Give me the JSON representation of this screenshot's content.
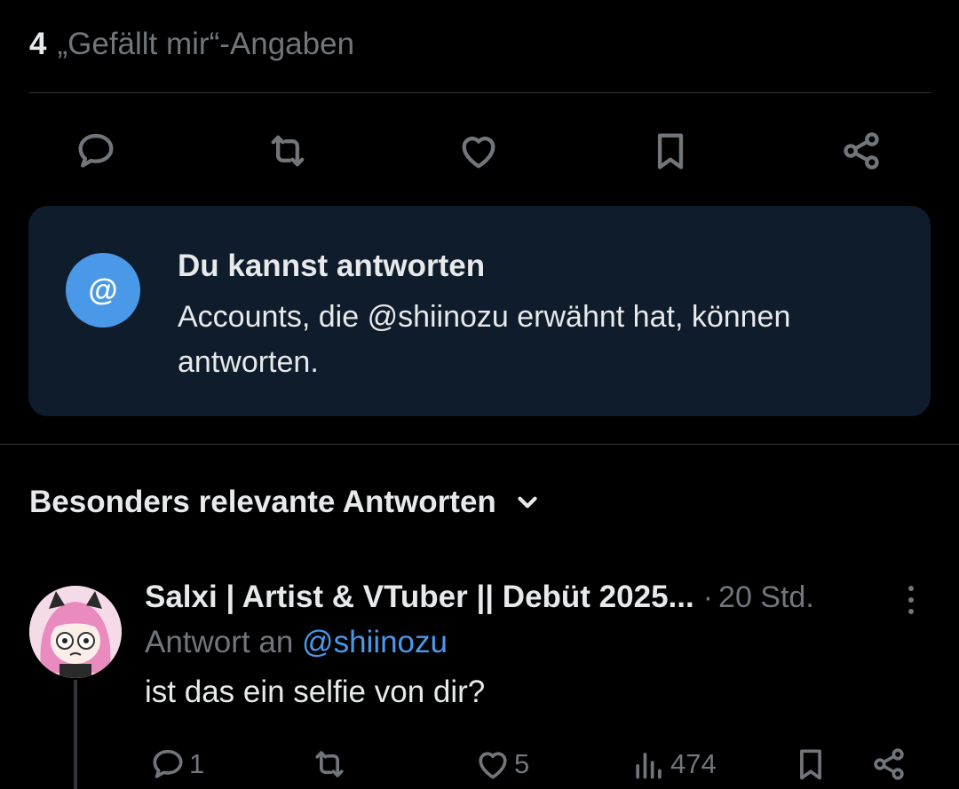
{
  "likes": {
    "count": "4",
    "label": "„Gefällt mir“-Angaben"
  },
  "actions": [
    {
      "name": "reply",
      "icon": "reply-icon"
    },
    {
      "name": "repost",
      "icon": "repost-icon"
    },
    {
      "name": "like",
      "icon": "heart-icon"
    },
    {
      "name": "bookmark",
      "icon": "bookmark-icon"
    },
    {
      "name": "share",
      "icon": "share-icon"
    }
  ],
  "reply_card": {
    "badge": "@",
    "title": "Du kannst antworten",
    "description": "Accounts, die @shiinozu erwähnt hat, können antworten."
  },
  "sort": {
    "label": "Besonders relevante Antworten",
    "icon": "chevron-down-icon"
  },
  "reply_post": {
    "author": "Salxi | Artist & VTuber || Debüt 2025...",
    "separator": "·",
    "time": "20 Std.",
    "reply_prefix": "Antwort an",
    "reply_mention": "@shiinozu",
    "text": "ist das ein selfie von dir?",
    "replies": "1",
    "reposts": "",
    "likes": "5",
    "views": "474"
  },
  "colors": {
    "background": "#000000",
    "text": "#e7e9ea",
    "muted": "#71767b",
    "accent": "#4a99e9",
    "card": "#0f1c2b",
    "divider": "#2f3336"
  }
}
